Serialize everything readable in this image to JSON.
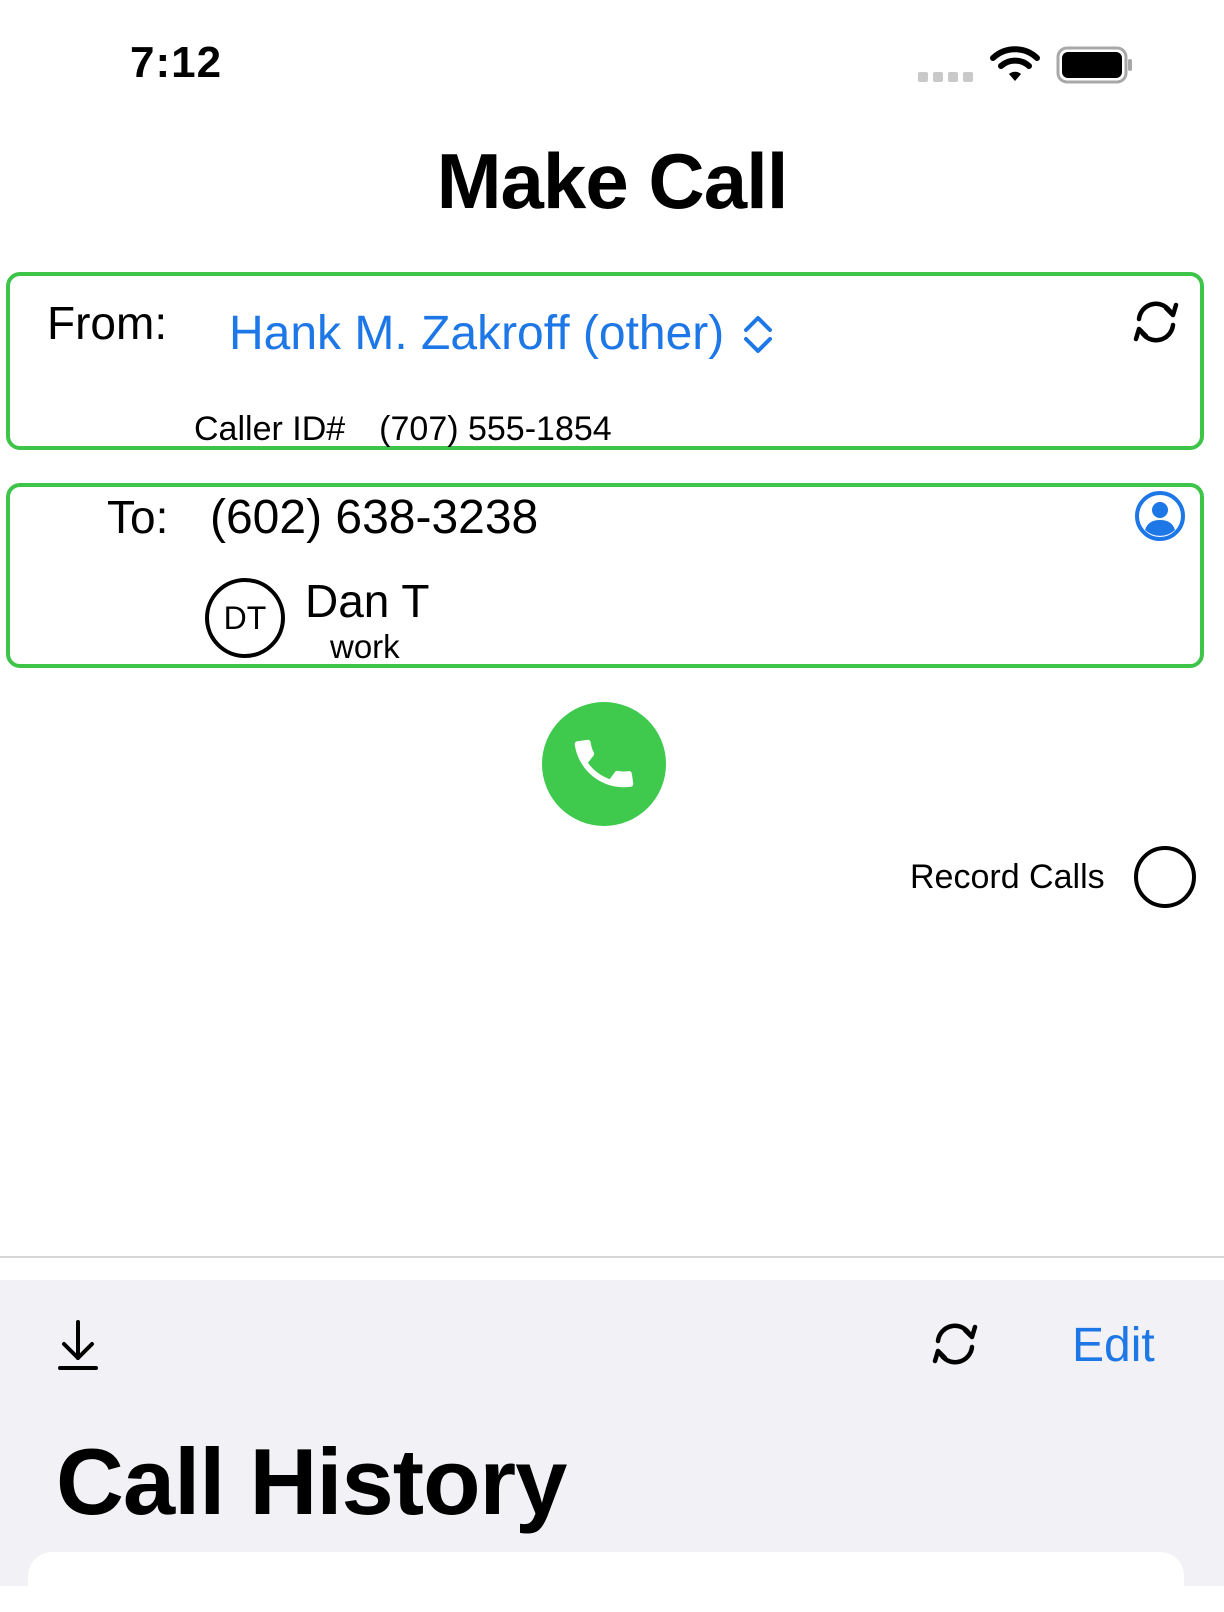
{
  "status_bar": {
    "time": "7:12"
  },
  "header": {
    "title": "Make Call"
  },
  "from": {
    "label": "From:",
    "selected_account": "Hank M. Zakroff (other)",
    "caller_id_label": "Caller ID#",
    "caller_id_number": "(707) 555-1854"
  },
  "to": {
    "label": "To:",
    "number": "(602) 638-3238",
    "contact": {
      "initials": "DT",
      "name": "Dan T",
      "type": "work"
    }
  },
  "record": {
    "label": "Record Calls",
    "enabled": false
  },
  "history": {
    "title": "Call History",
    "edit_label": "Edit"
  },
  "colors": {
    "accent": "#1d77e6",
    "success": "#3fc94d",
    "card_border": "#3fc44a",
    "panel_bg": "#f1f1f6"
  },
  "icons": [
    "signal-icon",
    "wifi-icon",
    "battery-icon",
    "selector-chevron-icon",
    "refresh-icon",
    "contacts-icon",
    "phone-icon",
    "download-icon"
  ]
}
